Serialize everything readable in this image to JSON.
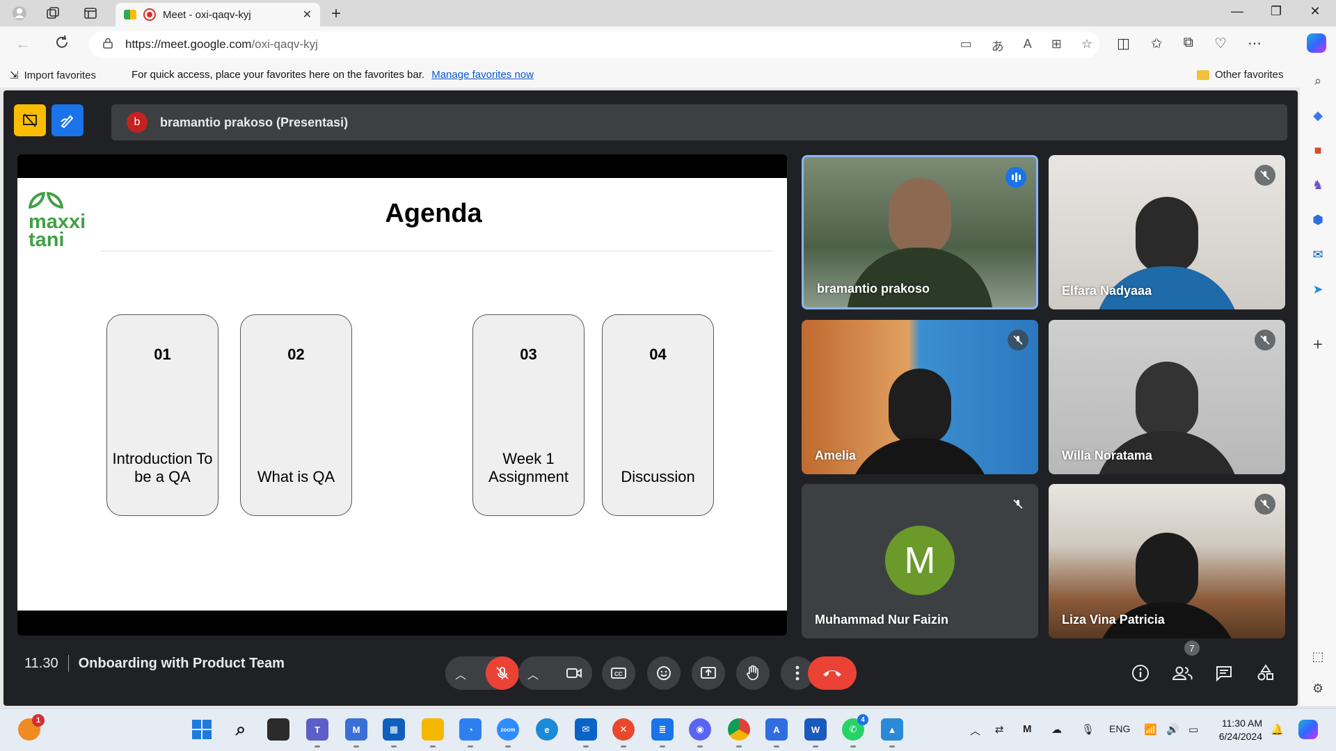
{
  "browser": {
    "tab_title": "Meet - oxi-qaqv-kyj",
    "new_tab": "+",
    "tab_close": "✕",
    "url_host": "https://meet.google.com",
    "url_path": "/oxi-qaqv-kyj",
    "window_controls": [
      "—",
      "❐",
      "✕"
    ]
  },
  "favorites_bar": {
    "import_label": "Import favorites",
    "hint_text": "For quick access, place your favorites here on the favorites bar.",
    "manage_link": "Manage favorites now",
    "other_label": "Other favorites"
  },
  "meet": {
    "presenter_initial": "b",
    "presenter_label": "bramantio prakoso (Presentasi)",
    "meeting_time": "11.30",
    "meeting_title": "Onboarding with Product Team",
    "participant_count": "7"
  },
  "slide": {
    "logo_line1": "maxxi",
    "logo_line2": "tani",
    "title": "Agenda",
    "cards": [
      {
        "num": "01",
        "label": "Introduction To be a QA"
      },
      {
        "num": "02",
        "label": "What is QA"
      },
      {
        "num": "03",
        "label": "Week 1 Assignment"
      },
      {
        "num": "04",
        "label": "Discussion"
      }
    ]
  },
  "participants": [
    {
      "name": "bramantio prakoso",
      "state": "speaking"
    },
    {
      "name": "Elfara Nadyaaa",
      "state": "muted"
    },
    {
      "name": "Amelia",
      "state": "muted"
    },
    {
      "name": "Willa Noratama",
      "state": "muted"
    },
    {
      "name": "Muhammad Nur Faizin",
      "state": "muted",
      "avatar_letter": "M"
    },
    {
      "name": "Liza Vina Patricia",
      "state": "muted"
    }
  ],
  "taskbar": {
    "notification_count": "1",
    "whatsapp_badge": "4",
    "language": "ENG",
    "time": "11:30 AM",
    "date": "6/24/2024"
  },
  "colors": {
    "meet_bg": "#202124",
    "tile_bg": "#3c4043",
    "leave_red": "#ea4335",
    "accent_blue": "#1a73e8",
    "brand_green": "#43a047"
  }
}
